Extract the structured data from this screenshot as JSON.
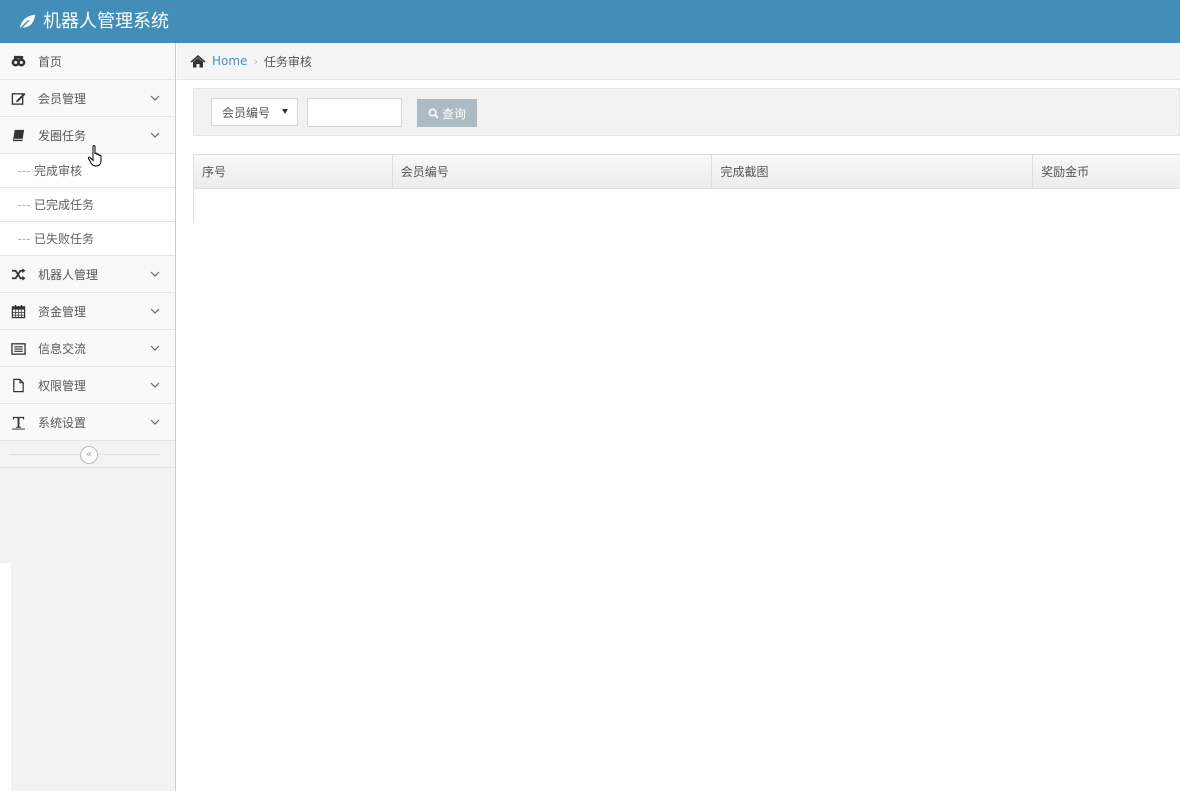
{
  "app": {
    "title": "机器人管理系统"
  },
  "sidebar": {
    "items": [
      {
        "label": "首页",
        "icon": "dashboard-icon",
        "expandable": false
      },
      {
        "label": "会员管理",
        "icon": "edit-icon",
        "expandable": true
      },
      {
        "label": "发圈任务",
        "icon": "book-icon",
        "expandable": true,
        "expanded": true,
        "children": [
          {
            "label": "完成审核",
            "active": true
          },
          {
            "label": "已完成任务"
          },
          {
            "label": "已失败任务"
          }
        ]
      },
      {
        "label": "机器人管理",
        "icon": "random-icon",
        "expandable": true
      },
      {
        "label": "资金管理",
        "icon": "calendar-icon",
        "expandable": true
      },
      {
        "label": "信息交流",
        "icon": "list-icon",
        "expandable": true
      },
      {
        "label": "权限管理",
        "icon": "file-icon",
        "expandable": true
      },
      {
        "label": "系统设置",
        "icon": "text-icon",
        "expandable": true
      }
    ],
    "collapse_glyph": "«"
  },
  "breadcrumb": {
    "home": "Home",
    "separator": "›",
    "current": "任务审核"
  },
  "search": {
    "field_selected": "会员编号",
    "input_value": "",
    "button_label": "查询"
  },
  "table": {
    "columns": [
      "序号",
      "会员编号",
      "完成截图",
      "奖励金币"
    ],
    "rows": []
  },
  "colors": {
    "header": "#438eb9",
    "search_button": "#abbac3",
    "link": "#4c8fbd"
  }
}
